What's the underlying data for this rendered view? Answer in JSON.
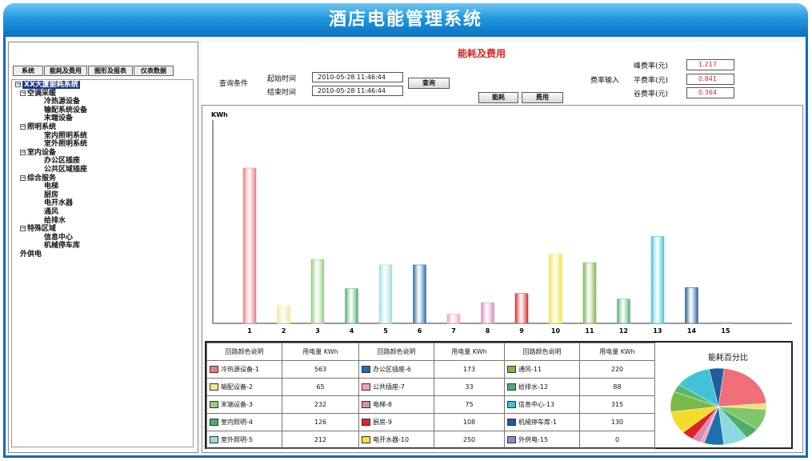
{
  "app": {
    "title": "酒店电能管理系统"
  },
  "tabs": [
    {
      "label": "系统"
    },
    {
      "label": "能耗及费用"
    },
    {
      "label": "图形及报表"
    },
    {
      "label": "仪表数据"
    }
  ],
  "tree": [
    {
      "label": "XX大厦能耗系统",
      "level": 0,
      "expander": "⊟",
      "selected": true
    },
    {
      "label": "空调采暖",
      "level": 1,
      "expander": "⊟"
    },
    {
      "label": "冷热源设备",
      "level": 2
    },
    {
      "label": "输配系统设备",
      "level": 2
    },
    {
      "label": "末端设备",
      "level": 2
    },
    {
      "label": "照明系统",
      "level": 1,
      "expander": "⊟"
    },
    {
      "label": "室内照明系统",
      "level": 2
    },
    {
      "label": "室外照明系统",
      "level": 2
    },
    {
      "label": "室内设备",
      "level": 1,
      "expander": "⊟"
    },
    {
      "label": "办公区插座",
      "level": 2
    },
    {
      "label": "公共区域插座",
      "level": 2
    },
    {
      "label": "综合服务",
      "level": 1,
      "expander": "⊟"
    },
    {
      "label": "电梯",
      "level": 2
    },
    {
      "label": "厨房",
      "level": 2
    },
    {
      "label": "电开水器",
      "level": 2
    },
    {
      "label": "通风",
      "level": 2
    },
    {
      "label": "给排水",
      "level": 2
    },
    {
      "label": "特殊区域",
      "level": 1,
      "expander": "⊟"
    },
    {
      "label": "信息中心",
      "level": 2
    },
    {
      "label": "机械停车库",
      "level": 2
    },
    {
      "label": "外供电",
      "level": 1
    }
  ],
  "panel": {
    "title": "能耗及费用"
  },
  "query": {
    "condition_label": "查询条件",
    "start_label": "起始时间",
    "end_label": "结束时间",
    "start_value": "2010-05-28 11:46:44",
    "end_value": "2010-05-28 11:46:44",
    "query_button": "查询",
    "energy_button": "能耗",
    "cost_button": "费用"
  },
  "rates": {
    "input_label": "费率输入",
    "peak_label": "峰费率(元)",
    "flat_label": "平费率(元)",
    "valley_label": "谷费率(元)",
    "peak_value": "1.217",
    "flat_value": "0.841",
    "valley_value": "0.364"
  },
  "chart_data": {
    "type": "bar",
    "ylabel": "KWh",
    "categories": [
      "1",
      "2",
      "3",
      "4",
      "5",
      "6",
      "7",
      "8",
      "9",
      "10",
      "11",
      "12",
      "13",
      "14",
      "15"
    ],
    "values": [
      563,
      65,
      232,
      126,
      212,
      212,
      33,
      75,
      108,
      250,
      220,
      88,
      315,
      130,
      0
    ],
    "colors": [
      "#f07a80",
      "#f8e58c",
      "#8fcf78",
      "#4dae6c",
      "#9adce2",
      "#1f6fb0",
      "#f2a0b8",
      "#d88ab8",
      "#e02424",
      "#f4e03c",
      "#7ab84a",
      "#4dae6c",
      "#42c2d8",
      "#1f5e9a",
      "#8e88c8"
    ],
    "grid": false,
    "legend": "table below chart"
  },
  "table": {
    "headers": [
      "回路颜色说明",
      "用电量 KWh"
    ],
    "rows": [
      [
        {
          "name": "冷热源设备-1",
          "value": "563",
          "color": "#f07a80"
        },
        {
          "name": "办公区插座-6",
          "value": "173",
          "color": "#1f6fb0"
        },
        {
          "name": "通风-11",
          "value": "220",
          "color": "#7ab84a"
        }
      ],
      [
        {
          "name": "输配设备-2",
          "value": "65",
          "color": "#f8e58c"
        },
        {
          "name": "公共插座-7",
          "value": "33",
          "color": "#f2a0b8"
        },
        {
          "name": "给排水-12",
          "value": "88",
          "color": "#4dae6c"
        }
      ],
      [
        {
          "name": "末端设备-3",
          "value": "232",
          "color": "#8fcf78"
        },
        {
          "name": "电梯-8",
          "value": "75",
          "color": "#d88ab8"
        },
        {
          "name": "信息中心-13",
          "value": "315",
          "color": "#42c2d8"
        }
      ],
      [
        {
          "name": "室内照明-4",
          "value": "126",
          "color": "#4dae6c"
        },
        {
          "name": "厨房-9",
          "value": "108",
          "color": "#e02424"
        },
        {
          "name": "机械停车库-1",
          "value": "130",
          "color": "#1f5e9a"
        }
      ],
      [
        {
          "name": "室外照明-5",
          "value": "212",
          "color": "#9adce2"
        },
        {
          "name": "电开水器-10",
          "value": "250",
          "color": "#f4e03c"
        },
        {
          "name": "外供电-15",
          "value": "0",
          "color": "#8e88c8"
        }
      ]
    ]
  },
  "pie": {
    "title": "能耗百分比",
    "slices": [
      {
        "value": 563,
        "color": "#f06e78"
      },
      {
        "value": 65,
        "color": "#f8e070"
      },
      {
        "value": 232,
        "color": "#7ec86a"
      },
      {
        "value": 126,
        "color": "#4dae6c"
      },
      {
        "value": 212,
        "color": "#8cd8e0"
      },
      {
        "value": 173,
        "color": "#1f6fb0"
      },
      {
        "value": 33,
        "color": "#f2a0b8"
      },
      {
        "value": 75,
        "color": "#d88ab8"
      },
      {
        "value": 108,
        "color": "#e02424"
      },
      {
        "value": 250,
        "color": "#f4dc2c"
      },
      {
        "value": 220,
        "color": "#7ab84a"
      },
      {
        "value": 88,
        "color": "#58b870"
      },
      {
        "value": 315,
        "color": "#42c2d8"
      },
      {
        "value": 130,
        "color": "#1f5e9a"
      }
    ]
  }
}
